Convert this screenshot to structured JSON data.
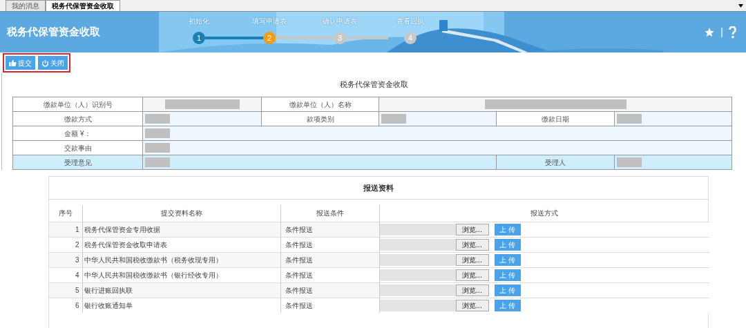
{
  "tabs": [
    {
      "label": "我的消息",
      "selected": false
    },
    {
      "label": "税务代保管资金收取",
      "selected": true
    }
  ],
  "banner": {
    "title": "税务代保管资金收取",
    "steps": [
      {
        "number": "1",
        "label": "初始化",
        "done": true,
        "current": false
      },
      {
        "number": "2",
        "label": "填写申请表",
        "done": false,
        "current": true
      },
      {
        "number": "3",
        "label": "确认申请表",
        "done": false,
        "current": false
      },
      {
        "number": "4",
        "label": "查看回执",
        "done": false,
        "current": false
      }
    ],
    "divider": "|"
  },
  "toolbar": {
    "highlighted": true,
    "buttons": [
      {
        "label": "提交",
        "kind": "submit"
      },
      {
        "label": "关闭",
        "kind": "close"
      }
    ]
  },
  "form": {
    "title": "税务代保管资金收取",
    "rows": [
      {
        "highlighted": false,
        "cells": [
          {
            "kind": "label",
            "text": "缴款单位（人）识别号"
          },
          {
            "kind": "value"
          },
          {
            "kind": "label",
            "text": "缴款单位（人）名称"
          },
          {
            "kind": "value"
          },
          {
            "kind": "merged"
          },
          {
            "kind": "merged"
          }
        ]
      },
      {
        "highlighted": false,
        "cells": [
          {
            "kind": "label",
            "text": "缴款方式"
          },
          {
            "kind": "value"
          },
          {
            "kind": "label",
            "text": "款项类别"
          },
          {
            "kind": "value"
          },
          {
            "kind": "label",
            "text": "缴款日期"
          },
          {
            "kind": "value"
          }
        ]
      },
      {
        "highlighted": false,
        "cells": [
          {
            "kind": "label",
            "text": "金额 ¥："
          },
          {
            "kind": "value"
          },
          {
            "kind": "merged"
          },
          {
            "kind": "merged"
          },
          {
            "kind": "merged"
          },
          {
            "kind": "merged"
          }
        ]
      },
      {
        "highlighted": false,
        "cells": [
          {
            "kind": "label",
            "text": "交款事由"
          },
          {
            "kind": "value"
          },
          {
            "kind": "merged"
          },
          {
            "kind": "merged"
          },
          {
            "kind": "merged"
          },
          {
            "kind": "merged"
          }
        ]
      },
      {
        "highlighted": true,
        "cells": [
          {
            "kind": "label",
            "text": "受理意见"
          },
          {
            "kind": "value"
          },
          {
            "kind": "merged"
          },
          {
            "kind": "merged"
          },
          {
            "kind": "label",
            "text": "受理人"
          },
          {
            "kind": "value"
          }
        ]
      }
    ]
  },
  "materials": {
    "title": "报送资料",
    "columns": [
      "序号",
      "提交资料名称",
      "报送条件",
      "报送方式"
    ],
    "rows": [
      {
        "index": "1",
        "name": "税务代保管资金专用收据",
        "condition": "条件报送",
        "browse": "浏览...",
        "upload": "上 传"
      },
      {
        "index": "2",
        "name": "税务代保管资金收取申请表",
        "condition": "条件报送",
        "browse": "浏览...",
        "upload": "上 传"
      },
      {
        "index": "3",
        "name": "中华人民共和国税收缴款书（税务收现专用）",
        "condition": "条件报送",
        "browse": "浏览...",
        "upload": "上 传"
      },
      {
        "index": "4",
        "name": "中华人民共和国税收缴款书（银行经收专用）",
        "condition": "条件报送",
        "browse": "浏览...",
        "upload": "上 传"
      },
      {
        "index": "5",
        "name": "银行进账回执联",
        "condition": "条件报送",
        "browse": "浏览...",
        "upload": "上 传"
      },
      {
        "index": "6",
        "name": "银行收账通知单",
        "condition": "条件报送",
        "browse": "浏览...",
        "upload": "上 传"
      }
    ]
  }
}
